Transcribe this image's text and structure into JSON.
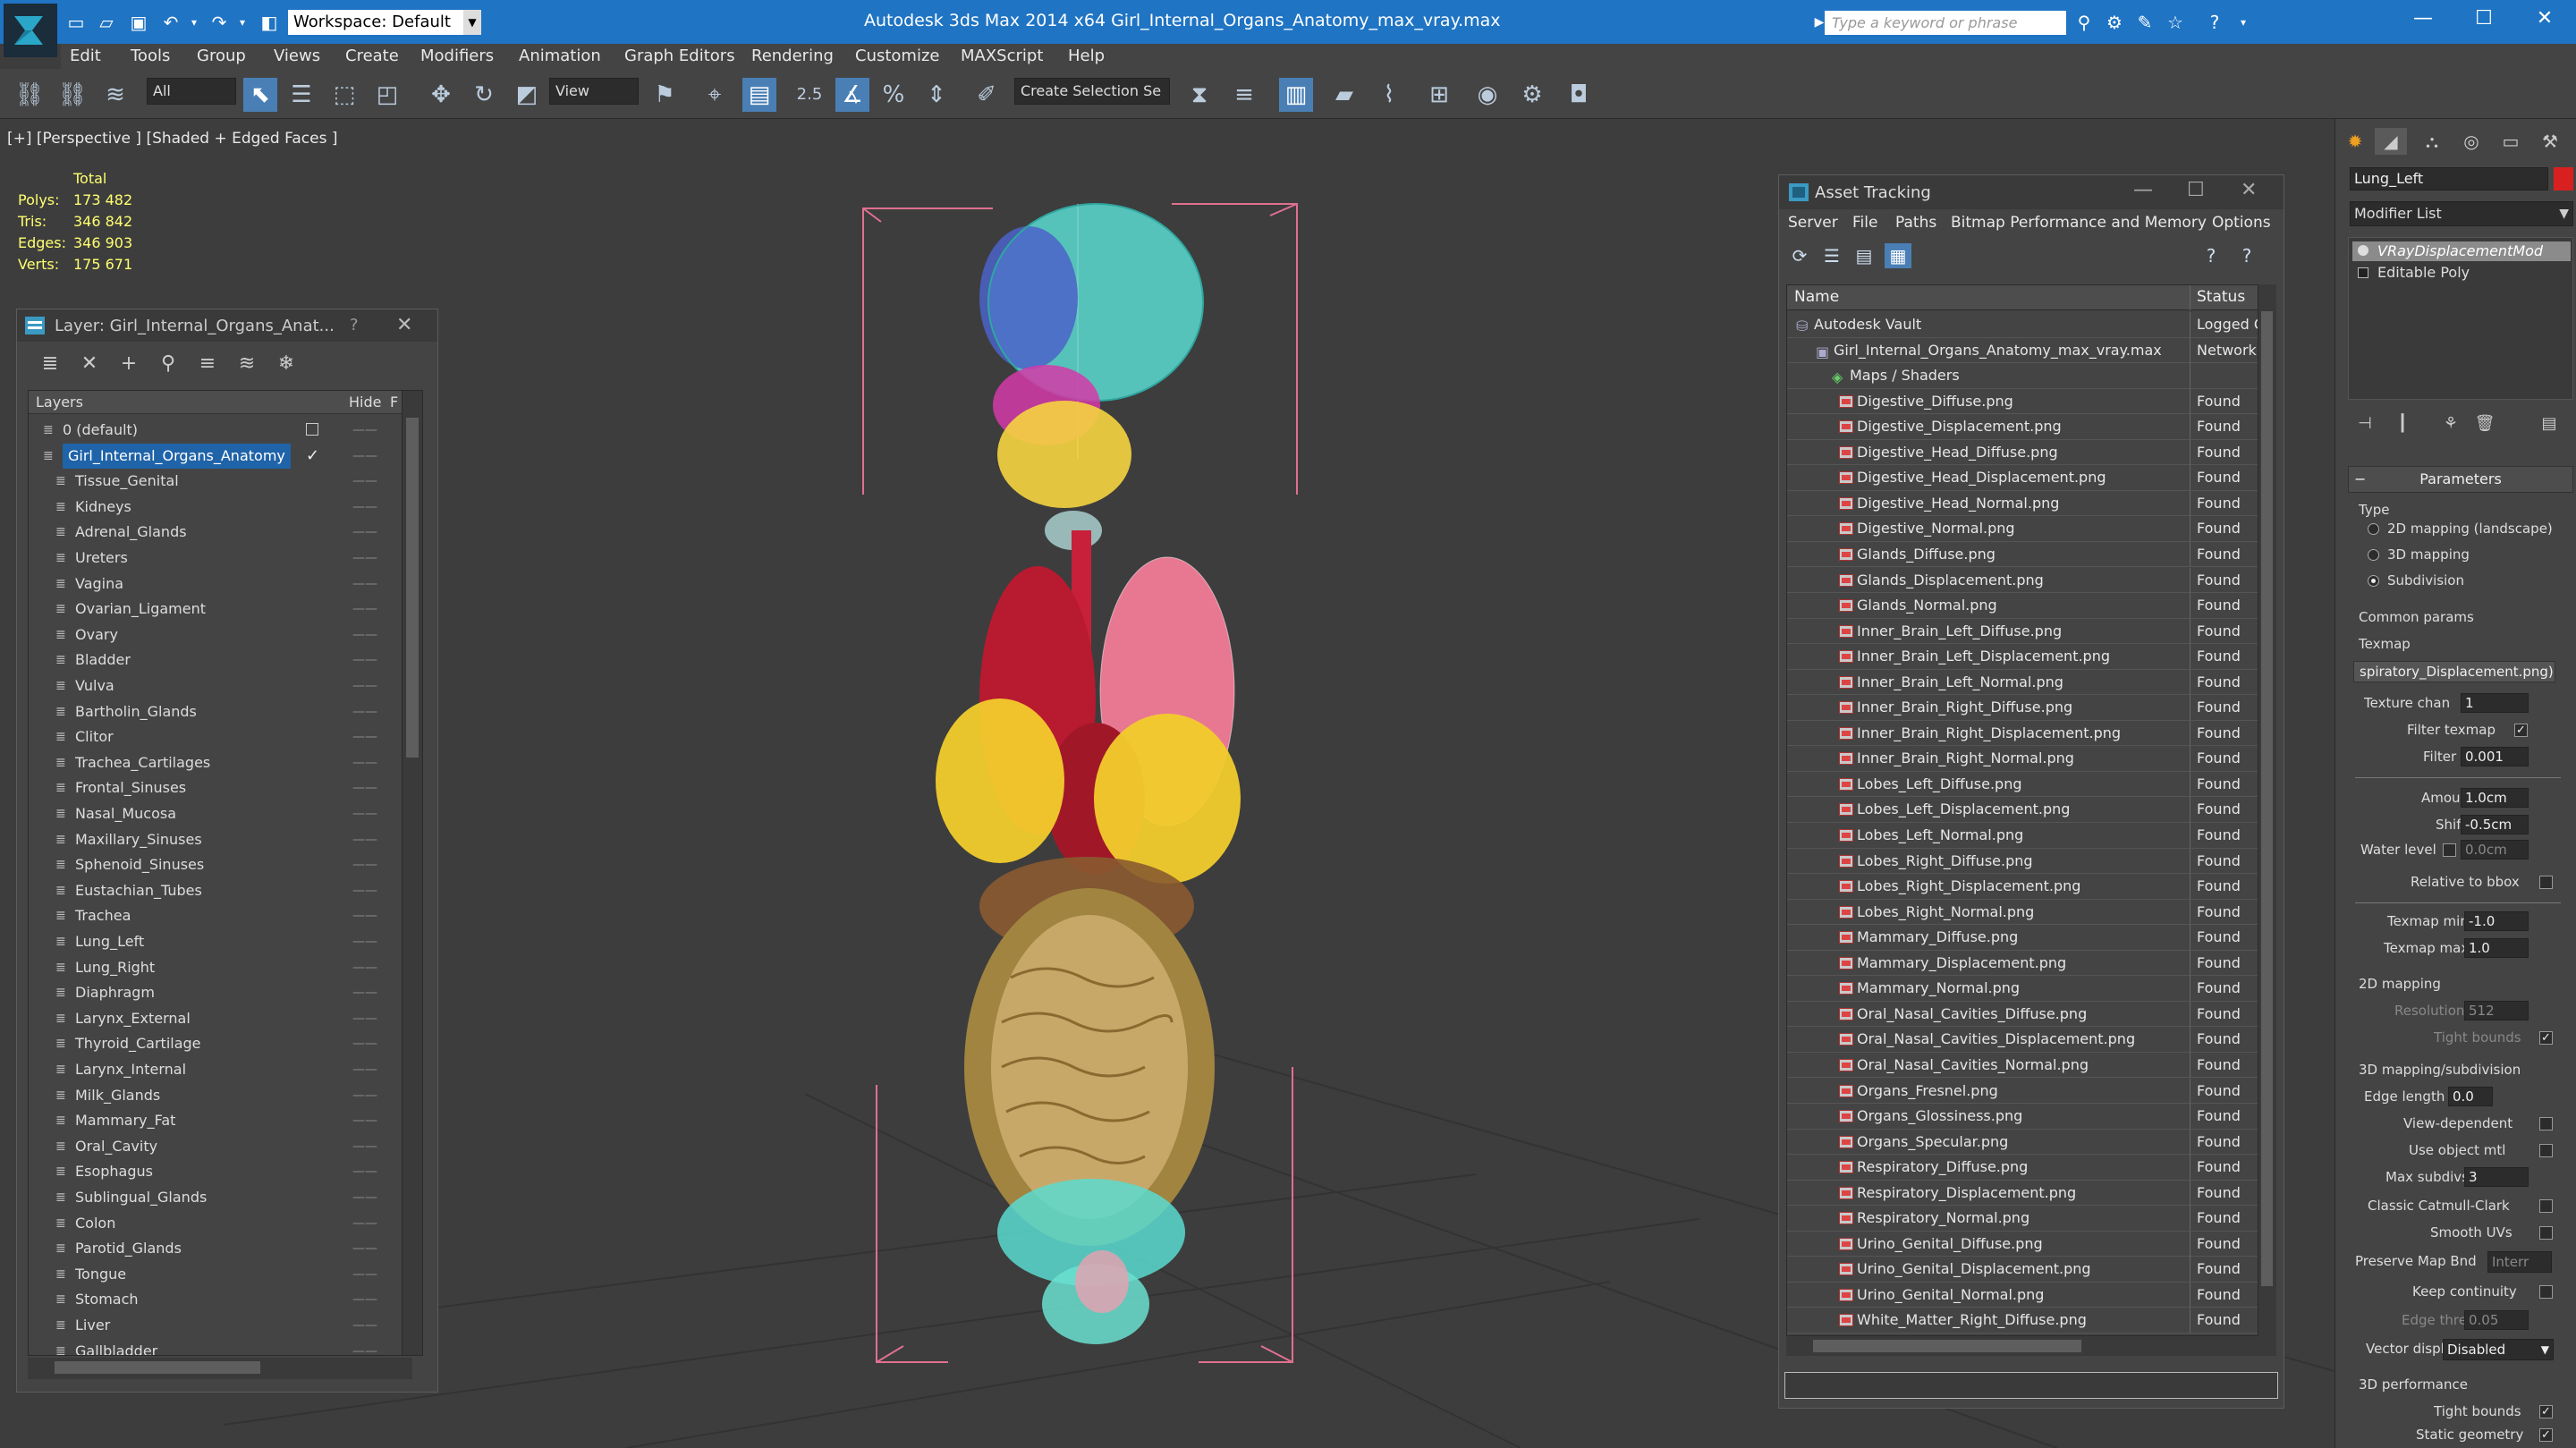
{
  "title_bar": {
    "workspace": "Workspace: Default",
    "app_title": "Autodesk 3ds Max  2014 x64     Girl_Internal_Organs_Anatomy_max_vray.max",
    "search_placeholder": "Type a keyword or phrase"
  },
  "menu": [
    "Edit",
    "Tools",
    "Group",
    "Views",
    "Create",
    "Modifiers",
    "Animation",
    "Graph Editors",
    "Rendering",
    "Customize",
    "MAXScript",
    "Help"
  ],
  "toolbar": {
    "selection_filter": "All",
    "ref_coord": "View",
    "selection_set": "Create Selection Se",
    "snap_value": "2.5"
  },
  "viewport": {
    "label": "[+] [Perspective ] [Shaded + Edged Faces ]",
    "stats_header": "Total",
    "stats": [
      {
        "label": "Polys:",
        "value": "173 482"
      },
      {
        "label": "Tris:",
        "value": "346 842"
      },
      {
        "label": "Edges:",
        "value": "346 903"
      },
      {
        "label": "Verts:",
        "value": "175 671"
      }
    ]
  },
  "layer_window": {
    "title": "Layer: Girl_Internal_Organs_Anat...",
    "help": "?",
    "col_layers": "Layers",
    "col_hide": "Hide",
    "col_f": "F",
    "layers": [
      {
        "name": "0 (default)",
        "level": 0
      },
      {
        "name": "Girl_Internal_Organs_Anatomy",
        "level": 0,
        "selected": true
      },
      {
        "name": "Tissue_Genital",
        "level": 1
      },
      {
        "name": "Kidneys",
        "level": 1
      },
      {
        "name": "Adrenal_Glands",
        "level": 1
      },
      {
        "name": "Ureters",
        "level": 1
      },
      {
        "name": "Vagina",
        "level": 1
      },
      {
        "name": "Ovarian_Ligament",
        "level": 1
      },
      {
        "name": "Ovary",
        "level": 1
      },
      {
        "name": "Bladder",
        "level": 1
      },
      {
        "name": "Vulva",
        "level": 1
      },
      {
        "name": "Bartholin_Glands",
        "level": 1
      },
      {
        "name": "Clitor",
        "level": 1
      },
      {
        "name": "Trachea_Cartilages",
        "level": 1
      },
      {
        "name": "Frontal_Sinuses",
        "level": 1
      },
      {
        "name": "Nasal_Mucosa",
        "level": 1
      },
      {
        "name": "Maxillary_Sinuses",
        "level": 1
      },
      {
        "name": "Sphenoid_Sinuses",
        "level": 1
      },
      {
        "name": "Eustachian_Tubes",
        "level": 1
      },
      {
        "name": "Trachea",
        "level": 1
      },
      {
        "name": "Lung_Left",
        "level": 1
      },
      {
        "name": "Lung_Right",
        "level": 1
      },
      {
        "name": "Diaphragm",
        "level": 1
      },
      {
        "name": "Larynx_External",
        "level": 1
      },
      {
        "name": "Thyroid_Cartilage",
        "level": 1
      },
      {
        "name": "Larynx_Internal",
        "level": 1
      },
      {
        "name": "Milk_Glands",
        "level": 1
      },
      {
        "name": "Mammary_Fat",
        "level": 1
      },
      {
        "name": "Oral_Cavity",
        "level": 1
      },
      {
        "name": "Esophagus",
        "level": 1
      },
      {
        "name": "Sublingual_Glands",
        "level": 1
      },
      {
        "name": "Colon",
        "level": 1
      },
      {
        "name": "Parotid_Glands",
        "level": 1
      },
      {
        "name": "Tongue",
        "level": 1
      },
      {
        "name": "Stomach",
        "level": 1
      },
      {
        "name": "Liver",
        "level": 1
      },
      {
        "name": "Gallbladder",
        "level": 1
      }
    ]
  },
  "asset_tracking": {
    "title": "Asset Tracking",
    "menu": [
      "Server",
      "File",
      "Paths",
      "Bitmap Performance and Memory",
      "Options"
    ],
    "col_name": "Name",
    "col_status": "Status",
    "rows": [
      {
        "name": "Autodesk Vault",
        "status": "Logged O",
        "level": 1,
        "icon": "vault"
      },
      {
        "name": "Girl_Internal_Organs_Anatomy_max_vray.max",
        "status": "Network",
        "level": 2,
        "icon": "max"
      },
      {
        "name": "Maps / Shaders",
        "status": "",
        "level": 3,
        "icon": "maps"
      },
      {
        "name": "Digestive_Diffuse.png",
        "status": "Found",
        "level": 4,
        "icon": "png"
      },
      {
        "name": "Digestive_Displacement.png",
        "status": "Found",
        "level": 4,
        "icon": "png"
      },
      {
        "name": "Digestive_Head_Diffuse.png",
        "status": "Found",
        "level": 4,
        "icon": "png"
      },
      {
        "name": "Digestive_Head_Displacement.png",
        "status": "Found",
        "level": 4,
        "icon": "png"
      },
      {
        "name": "Digestive_Head_Normal.png",
        "status": "Found",
        "level": 4,
        "icon": "png"
      },
      {
        "name": "Digestive_Normal.png",
        "status": "Found",
        "level": 4,
        "icon": "png"
      },
      {
        "name": "Glands_Diffuse.png",
        "status": "Found",
        "level": 4,
        "icon": "png"
      },
      {
        "name": "Glands_Displacement.png",
        "status": "Found",
        "level": 4,
        "icon": "png"
      },
      {
        "name": "Glands_Normal.png",
        "status": "Found",
        "level": 4,
        "icon": "png"
      },
      {
        "name": "Inner_Brain_Left_Diffuse.png",
        "status": "Found",
        "level": 4,
        "icon": "png"
      },
      {
        "name": "Inner_Brain_Left_Displacement.png",
        "status": "Found",
        "level": 4,
        "icon": "png"
      },
      {
        "name": "Inner_Brain_Left_Normal.png",
        "status": "Found",
        "level": 4,
        "icon": "png"
      },
      {
        "name": "Inner_Brain_Right_Diffuse.png",
        "status": "Found",
        "level": 4,
        "icon": "png"
      },
      {
        "name": "Inner_Brain_Right_Displacement.png",
        "status": "Found",
        "level": 4,
        "icon": "png"
      },
      {
        "name": "Inner_Brain_Right_Normal.png",
        "status": "Found",
        "level": 4,
        "icon": "png"
      },
      {
        "name": "Lobes_Left_Diffuse.png",
        "status": "Found",
        "level": 4,
        "icon": "png"
      },
      {
        "name": "Lobes_Left_Displacement.png",
        "status": "Found",
        "level": 4,
        "icon": "png"
      },
      {
        "name": "Lobes_Left_Normal.png",
        "status": "Found",
        "level": 4,
        "icon": "png"
      },
      {
        "name": "Lobes_Right_Diffuse.png",
        "status": "Found",
        "level": 4,
        "icon": "png"
      },
      {
        "name": "Lobes_Right_Displacement.png",
        "status": "Found",
        "level": 4,
        "icon": "png"
      },
      {
        "name": "Lobes_Right_Normal.png",
        "status": "Found",
        "level": 4,
        "icon": "png"
      },
      {
        "name": "Mammary_Diffuse.png",
        "status": "Found",
        "level": 4,
        "icon": "png"
      },
      {
        "name": "Mammary_Displacement.png",
        "status": "Found",
        "level": 4,
        "icon": "png"
      },
      {
        "name": "Mammary_Normal.png",
        "status": "Found",
        "level": 4,
        "icon": "png"
      },
      {
        "name": "Oral_Nasal_Cavities_Diffuse.png",
        "status": "Found",
        "level": 4,
        "icon": "png"
      },
      {
        "name": "Oral_Nasal_Cavities_Displacement.png",
        "status": "Found",
        "level": 4,
        "icon": "png"
      },
      {
        "name": "Oral_Nasal_Cavities_Normal.png",
        "status": "Found",
        "level": 4,
        "icon": "png"
      },
      {
        "name": "Organs_Fresnel.png",
        "status": "Found",
        "level": 4,
        "icon": "png"
      },
      {
        "name": "Organs_Glossiness.png",
        "status": "Found",
        "level": 4,
        "icon": "png"
      },
      {
        "name": "Organs_Specular.png",
        "status": "Found",
        "level": 4,
        "icon": "png"
      },
      {
        "name": "Respiratory_Diffuse.png",
        "status": "Found",
        "level": 4,
        "icon": "png"
      },
      {
        "name": "Respiratory_Displacement.png",
        "status": "Found",
        "level": 4,
        "icon": "png"
      },
      {
        "name": "Respiratory_Normal.png",
        "status": "Found",
        "level": 4,
        "icon": "png"
      },
      {
        "name": "Urino_Genital_Diffuse.png",
        "status": "Found",
        "level": 4,
        "icon": "png"
      },
      {
        "name": "Urino_Genital_Displacement.png",
        "status": "Found",
        "level": 4,
        "icon": "png"
      },
      {
        "name": "Urino_Genital_Normal.png",
        "status": "Found",
        "level": 4,
        "icon": "png"
      },
      {
        "name": "White_Matter_Right_Diffuse.png",
        "status": "Found",
        "level": 4,
        "icon": "png"
      }
    ]
  },
  "command_panel": {
    "object_name": "Lung_Left",
    "object_color": "#d82020",
    "modifier_list": "Modifier List",
    "stack": [
      {
        "name": "VRayDisplacementMod",
        "selected": true
      },
      {
        "name": "Editable Poly",
        "selected": false
      }
    ],
    "params": {
      "rollout": "Parameters",
      "type_label": "Type",
      "type_options": [
        {
          "label": "2D mapping (landscape)",
          "on": false
        },
        {
          "label": "3D mapping",
          "on": false
        },
        {
          "label": "Subdivision",
          "on": true
        }
      ],
      "common_params": "Common params",
      "texmap_label": "Texmap",
      "texmap_value": "spiratory_Displacement.png)",
      "texture_chan_label": "Texture chan",
      "texture_chan": "1",
      "filter_texmap_label": "Filter texmap",
      "filter_blur_label": "Filter blur",
      "filter_blur": "0.001",
      "amount_label": "Amount",
      "amount": "1.0cm",
      "shift_label": "Shift",
      "shift": "-0.5cm",
      "water_level_label": "Water level",
      "water_level": "0.0cm",
      "relative_bbox_label": "Relative to bbox",
      "texmap_min_label": "Texmap min",
      "texmap_min": "-1.0",
      "texmap_max_label": "Texmap max",
      "texmap_max": "1.0",
      "mapping2d": "2D mapping",
      "resolution_label": "Resolution",
      "resolution": "512",
      "tight_bounds_label": "Tight bounds",
      "mapping3d": "3D mapping/subdivision",
      "edge_length_label": "Edge length",
      "edge_length": "0.0",
      "view_dependent_label": "View-dependent",
      "use_object_mtl_label": "Use object mtl",
      "max_subdivs_label": "Max subdivs",
      "max_subdivs": "3",
      "classic_cc_label": "Classic Catmull-Clark",
      "smooth_uvs_label": "Smooth UVs",
      "preserve_map_label": "Preserve Map Bnd",
      "preserve_map_value": "Interr",
      "keep_continuity_label": "Keep continuity",
      "edge_thresh_label": "Edge thresh",
      "edge_thresh": "0.05",
      "vector_displ_label": "Vector displ",
      "vector_displ": "Disabled",
      "perf3d": "3D performance",
      "tight_bounds2_label": "Tight bounds",
      "static_geometry_label": "Static geometry"
    }
  }
}
